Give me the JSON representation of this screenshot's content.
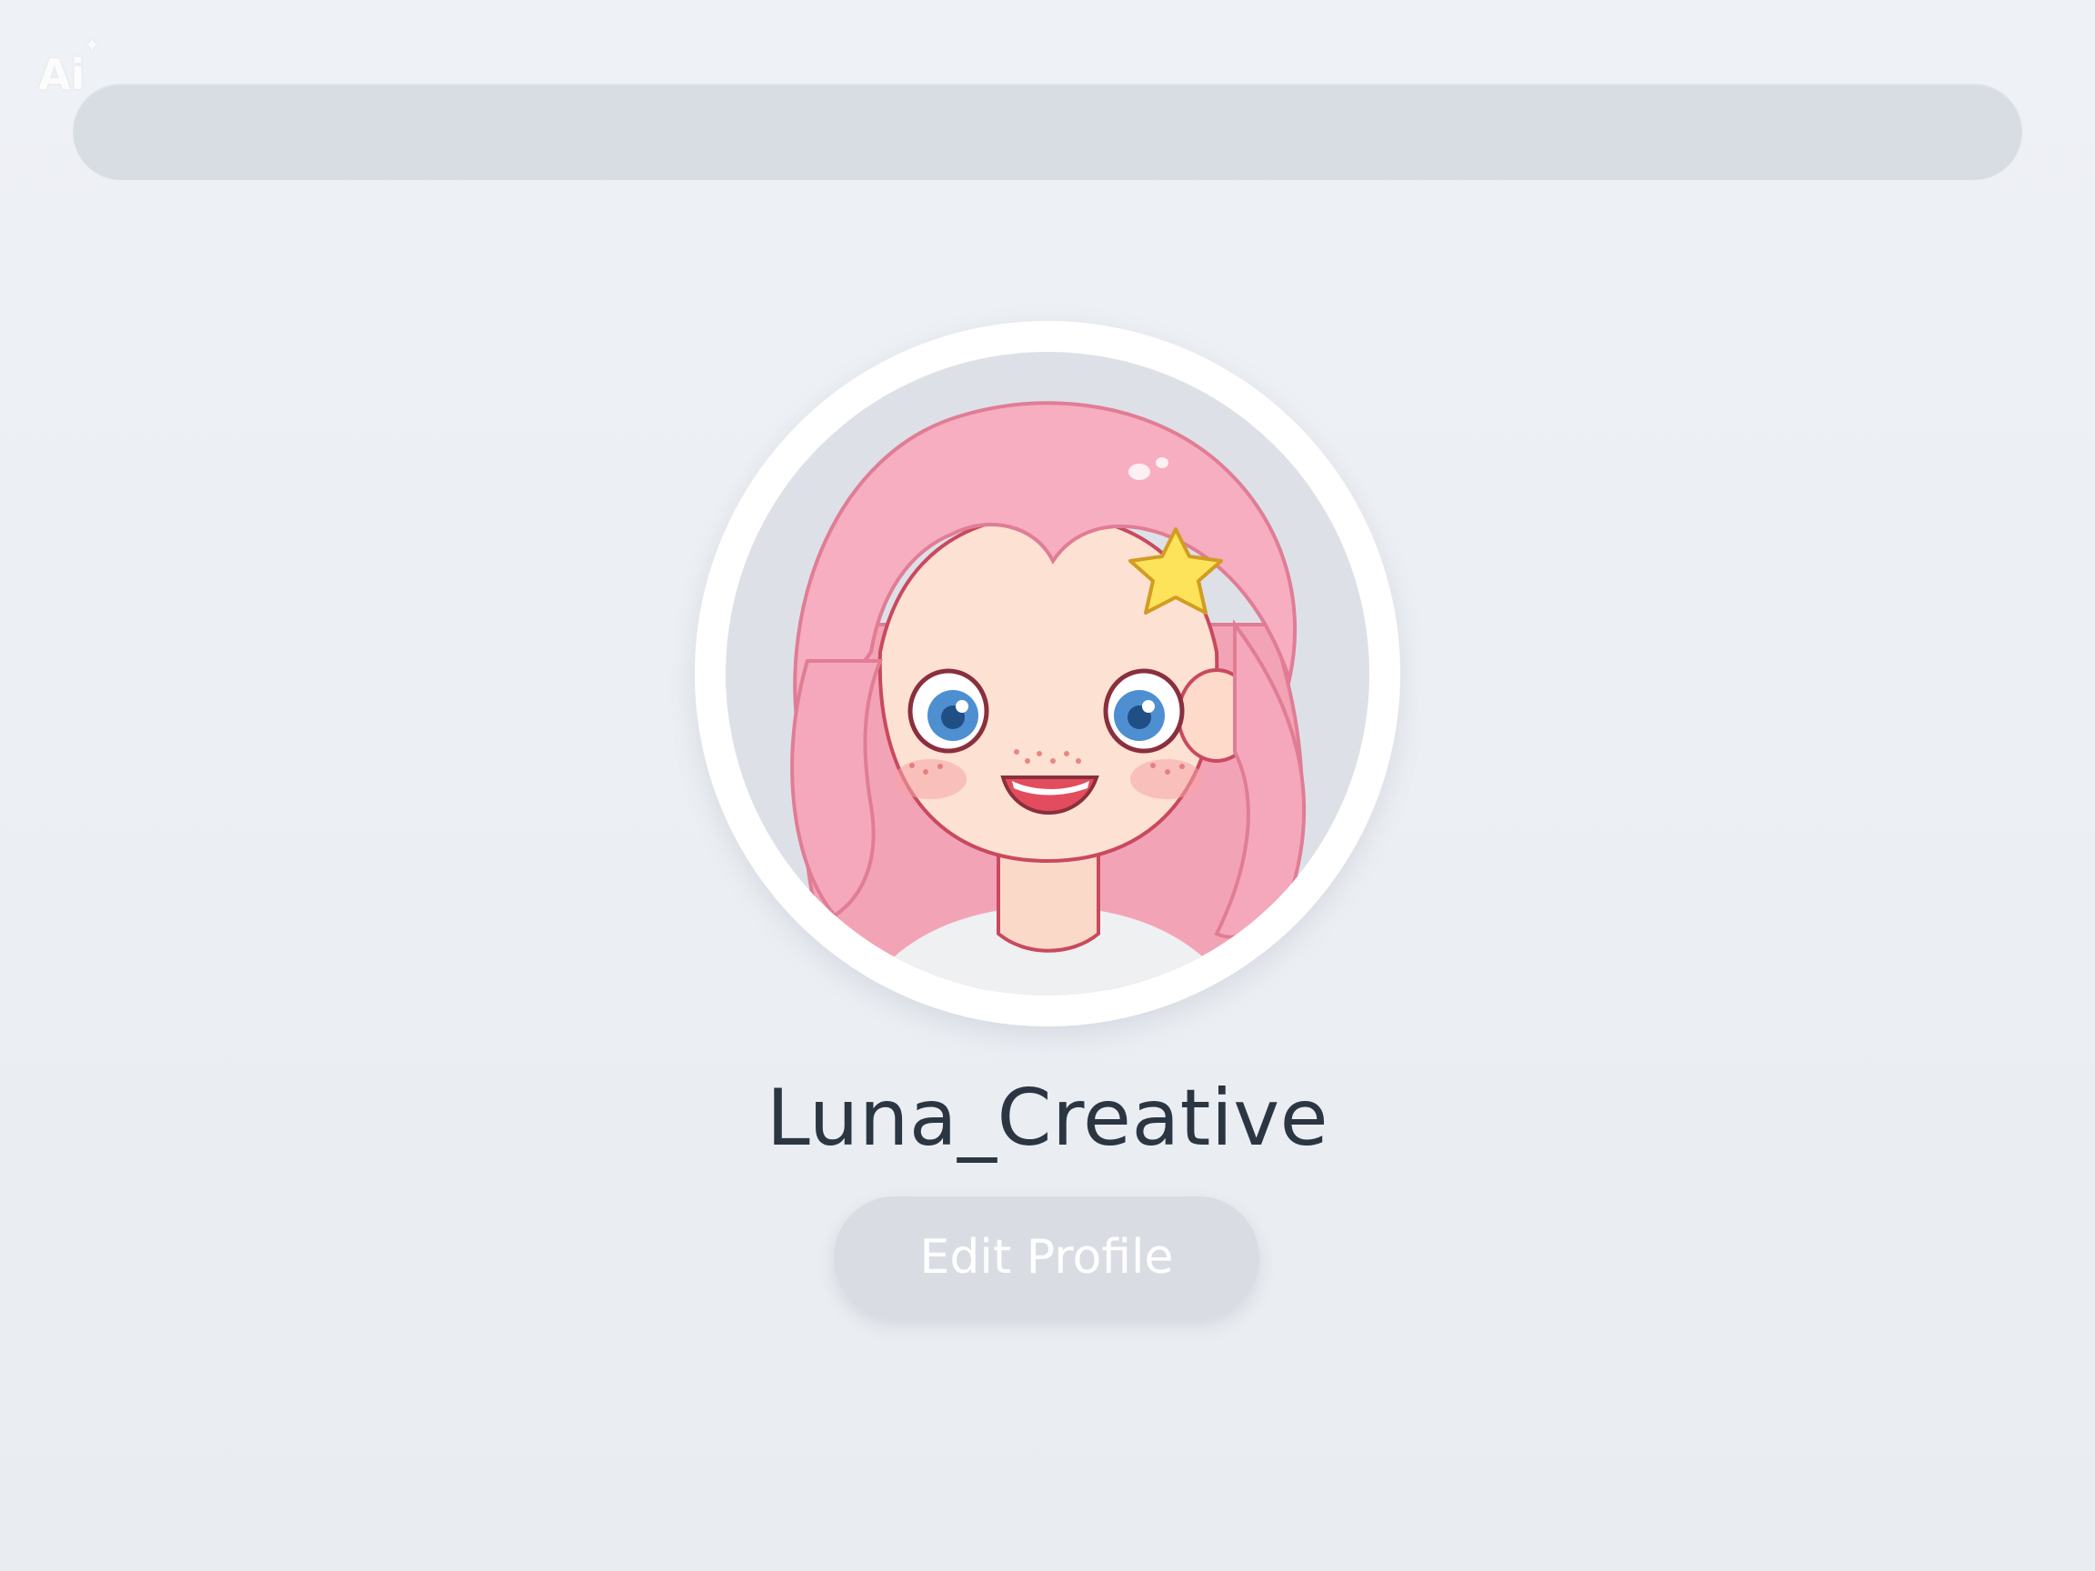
{
  "watermark": {
    "text": "Ai",
    "sparkle": "✦"
  },
  "search_bar": {
    "placeholder": ""
  },
  "profile": {
    "username": "Luna_Creative",
    "edit_button_label": "Edit Profile",
    "avatar_description_icon": "cartoon-girl-avatar"
  },
  "colors": {
    "background": "#edf0f4",
    "search_bar": "#d8dde4",
    "username_text": "#2b3642",
    "button_bg": "#d9dde3",
    "button_text": "#ffffff",
    "hair": "#f4a8ba",
    "star": "#fbe05a",
    "eyes": "#4d8fd1"
  }
}
